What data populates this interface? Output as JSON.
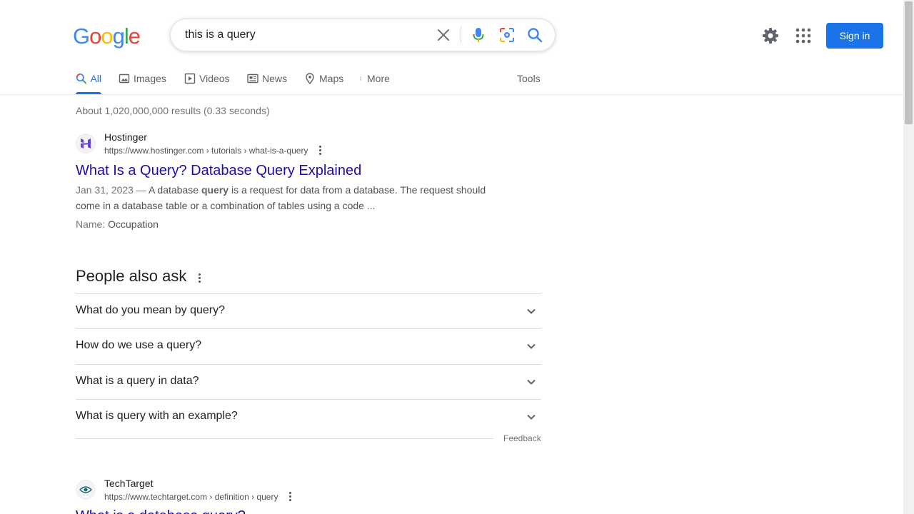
{
  "logo": {
    "text": "Google"
  },
  "search": {
    "value": "this is a query"
  },
  "header": {
    "signin_label": "Sign in"
  },
  "tabs": [
    {
      "label": "All",
      "icon": "search-icon"
    },
    {
      "label": "Images",
      "icon": "image-icon"
    },
    {
      "label": "Videos",
      "icon": "video-icon"
    },
    {
      "label": "News",
      "icon": "news-icon"
    },
    {
      "label": "Maps",
      "icon": "map-pin-icon"
    },
    {
      "label": "More",
      "icon": "more-vert-icon"
    }
  ],
  "tools_label": "Tools",
  "stats": "About 1,020,000,000 results (0.33 seconds)",
  "result1": {
    "site": "Hostinger",
    "url": "https://www.hostinger.com › tutorials › what-is-a-query",
    "title": "What Is a Query? Database Query Explained",
    "date": "Jan 31, 2023 —",
    "snippet_pre": " A database ",
    "snippet_bold": "query",
    "snippet_post": " is a request for data from a database. The request should come in a database table or a combination of tables using a code ...",
    "meta_label": "Name:",
    "meta_value": "Occupation"
  },
  "paa": {
    "title": "People also ask",
    "questions": [
      "What do you mean by query?",
      "How do we use a query?",
      "What is a query in data?",
      "What is query with an example?"
    ],
    "feedback": "Feedback"
  },
  "result2": {
    "site": "TechTarget",
    "url": "https://www.techtarget.com › definition › query",
    "title": "What is a database query?"
  },
  "colors": {
    "accent": "#1a73e8",
    "link": "#1a0dab"
  }
}
